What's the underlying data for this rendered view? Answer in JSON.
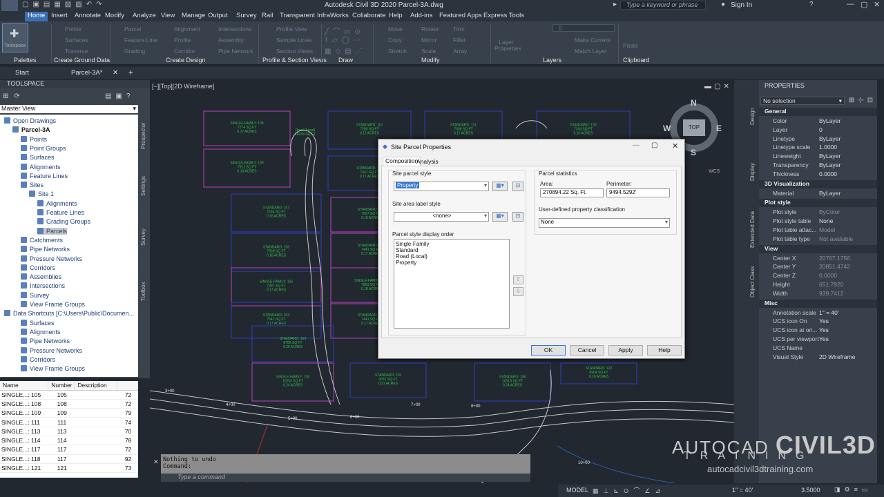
{
  "titlebar": {
    "app_title": "Autodesk Civil 3D 2020   Parcel-3A.dwg",
    "search_placeholder": "Type a keyword or phrase",
    "sign_in": "Sign In",
    "app_button": "C3D"
  },
  "menu_tabs": [
    "Home",
    "Insert",
    "Annotate",
    "Modify",
    "Analyze",
    "View",
    "Manage",
    "Output",
    "Survey",
    "Rail",
    "Transparent",
    "InfraWorks",
    "Collaborate",
    "Help",
    "Add-ins",
    "Featured Apps",
    "Express Tools"
  ],
  "ribbon": {
    "panels": [
      "Palettes",
      "Create Ground Data",
      "Create Design",
      "Profile & Section Views",
      "Draw",
      "Modify",
      "Layers",
      "Clipboard"
    ],
    "toolspace_label": "Toolspace",
    "ground_items": [
      "Points",
      "Surfaces",
      "Traverse"
    ],
    "design_items": [
      "Parcel",
      "Feature Line",
      "Grading",
      "Alignment",
      "Profile",
      "Corridor",
      "Intersections",
      "Assembly",
      "Pipe Network"
    ],
    "profile_items": [
      "Profile View",
      "Sample Lines",
      "Section Views"
    ],
    "modify_items": [
      "Move",
      "Copy",
      "Stretch",
      "Rotate",
      "Mirror",
      "Scale",
      "Trim",
      "Fillet",
      "Array"
    ],
    "layer_items": [
      "Layer Properties",
      "Make Current",
      "Match Layer"
    ],
    "layer_value": "0",
    "paste_label": "Paste"
  },
  "doc_tabs": {
    "start": "Start",
    "file": "Parcel-3A*"
  },
  "toolspace": {
    "title": "TOOLSPACE",
    "view_select": "Master View",
    "side_tabs": [
      "Prospector",
      "Settings",
      "Survey",
      "Toolbox"
    ],
    "tree": [
      {
        "label": "Open Drawings",
        "indent": 0
      },
      {
        "label": "Parcel-3A",
        "indent": 1,
        "bold": true
      },
      {
        "label": "Points",
        "indent": 2
      },
      {
        "label": "Point Groups",
        "indent": 2
      },
      {
        "label": "Surfaces",
        "indent": 2
      },
      {
        "label": "Alignments",
        "indent": 2
      },
      {
        "label": "Feature Lines",
        "indent": 2
      },
      {
        "label": "Sites",
        "indent": 2
      },
      {
        "label": "Site 1",
        "indent": 3
      },
      {
        "label": "Alignments",
        "indent": 4
      },
      {
        "label": "Feature Lines",
        "indent": 4
      },
      {
        "label": "Grading Groups",
        "indent": 4
      },
      {
        "label": "Parcels",
        "indent": 4,
        "selected": true
      },
      {
        "label": "Catchments",
        "indent": 2
      },
      {
        "label": "Pipe Networks",
        "indent": 2
      },
      {
        "label": "Pressure Networks",
        "indent": 2
      },
      {
        "label": "Corridors",
        "indent": 2
      },
      {
        "label": "Assemblies",
        "indent": 2
      },
      {
        "label": "Intersections",
        "indent": 2
      },
      {
        "label": "Survey",
        "indent": 2
      },
      {
        "label": "View Frame Groups",
        "indent": 2
      },
      {
        "label": "Data Shortcuts [C:\\Users\\Public\\Documen...",
        "indent": 0
      },
      {
        "label": "Surfaces",
        "indent": 2
      },
      {
        "label": "Alignments",
        "indent": 2
      },
      {
        "label": "Pipe Networks",
        "indent": 2
      },
      {
        "label": "Pressure Networks",
        "indent": 2
      },
      {
        "label": "Corridors",
        "indent": 2
      },
      {
        "label": "View Frame Groups",
        "indent": 2
      }
    ]
  },
  "list": {
    "headers": [
      "Name",
      "Number",
      "Description",
      ""
    ],
    "rows": [
      [
        "SINGLE...: 105",
        "105",
        "",
        "72"
      ],
      [
        "SINGLE...: 108",
        "108",
        "",
        "72"
      ],
      [
        "SINGLE...: 109",
        "109",
        "",
        "79"
      ],
      [
        "SINGLE...: 111",
        "111",
        "",
        "74"
      ],
      [
        "SINGLE...: 113",
        "113",
        "",
        "70"
      ],
      [
        "SINGLE...: 114",
        "114",
        "",
        "78"
      ],
      [
        "SINGLE...: 117",
        "117",
        "",
        "72"
      ],
      [
        "SINGLE...: 118",
        "117",
        "",
        "92"
      ],
      [
        "SINGLE...: 121",
        "121",
        "",
        "73"
      ]
    ]
  },
  "viewport": {
    "label": "[−][Top][2D Wireframe]",
    "compass": {
      "n": "N",
      "s": "S",
      "e": "E",
      "w": "W",
      "top": "TOP",
      "wcs": "WCS"
    }
  },
  "parcels": [
    {
      "t1": "SINGLE-FAMILY: 108",
      "t2": "7274 SQ FT",
      "t3": "0.17 ACRES",
      "c": "#c040c0"
    },
    {
      "t1": "STANDARD: 110",
      "t2": "7280 SQ FT",
      "t3": "0.17 ACRES",
      "c": "#3040c0"
    },
    {
      "t1": "STANDARD: 131",
      "t2": "7306 SQ FT",
      "t3": "0.17 ACRES",
      "c": "#3040c0"
    },
    {
      "t1": "STANDARD: 130",
      "t2": "7184 SQ FT",
      "t3": "0.16 ACRES",
      "c": "#3040c0"
    },
    {
      "t1": "SINGLE-FAMILY: 109",
      "t2": "7912 SQ FT",
      "t3": "0.18 ACRES",
      "c": "#c040c0"
    },
    {
      "t1": "STANDARD: 111",
      "t2": "7447 SQ FT",
      "t3": "0.17 ACRES",
      "c": "#3040c0"
    },
    {
      "t1": "STANDARD: 107",
      "t2": "7184 SQ FT",
      "t3": "0.16 ACRES",
      "c": "#3040c0"
    },
    {
      "t1": "STANDARD: 112",
      "t2": "7057 SQ FT",
      "t3": "0.16 ACRES",
      "c": "#c040c0"
    },
    {
      "t1": "STANDARD: 106",
      "t2": "7990 SQ FT",
      "t3": "0.18 ACRES",
      "c": "#3040c0"
    },
    {
      "t1": "STANDARD: 113",
      "t2": "7441 SQ FT",
      "t3": "0.17 ACRES",
      "c": "#c040c0"
    },
    {
      "t1": "SINGLE-FAMILY: 105",
      "t2": "7287 SQ FT",
      "t3": "0.17 ACRES",
      "c": "#c040c0"
    },
    {
      "t1": "SINGLE-FAMILY: 114",
      "t2": "7853 SQ FT",
      "t3": "0.18 ACRES",
      "c": "#c040c0"
    },
    {
      "t1": "STANDARD: 104",
      "t2": "7541 SQ FT",
      "t3": "0.17 ACRES",
      "c": "#3040c0"
    },
    {
      "t1": "STANDARD: 115",
      "t2": "7441 SQ FT",
      "t3": "0.17 ACRES",
      "c": "#c040c0"
    },
    {
      "t1": "STANDARD: 103",
      "t2": "8766 SQ FT",
      "t3": "0.20 ACRES",
      "c": "#3040c0"
    },
    {
      "t1": "SINGLE-FAMILY: 118",
      "t2": "10253 SQ FT",
      "t3": "0.24 ACRES",
      "c": "#c040c0"
    },
    {
      "t1": "STANDARD: 119",
      "t2": "9031 SQ FT",
      "t3": "0.21 ACRES",
      "c": "#3040c0"
    },
    {
      "t1": "STANDARD: 136",
      "t2": "10319 SQ FT",
      "t3": "0.24 ACRES",
      "c": "#3040c0"
    },
    {
      "t1": "STANDARD: 120",
      "t2": "6904 SQ FT",
      "t3": "0.16 ACRES",
      "c": "#3040c0"
    },
    {
      "t1": "Road (Local)",
      "t2": "10333 SQ FT",
      "t3": "",
      "c": "#3040c0"
    }
  ],
  "stations": [
    "3+00",
    "4+00",
    "5+00",
    "6+00",
    "7+00",
    "8+00",
    "10+00"
  ],
  "command": {
    "history": [
      "Nothing to undo",
      "Command:"
    ],
    "placeholder": "Type a command"
  },
  "dialog": {
    "title": "Site Parcel Properties",
    "tabs": [
      "Composition",
      "Analysis"
    ],
    "site_parcel_style_label": "Site parcel style",
    "site_parcel_style_value": "Property",
    "site_area_label_style_label": "Site area label style",
    "site_area_label_style_value": "<none>",
    "display_order_label": "Parcel style display order",
    "display_order_items": [
      "Single-Family",
      "Standard",
      "Road (Local)",
      "Property"
    ],
    "stats_label": "Parcel statistics",
    "area_label": "Area:",
    "area_value": "270894.22 Sq. Ft.",
    "perimeter_label": "Perimeter:",
    "perimeter_value": "9494.5292'",
    "udp_label": "User-defined property classification",
    "udp_value": "None",
    "buttons": [
      "OK",
      "Cancel",
      "Apply",
      "Help"
    ]
  },
  "properties": {
    "title": "PROPERTIES",
    "selection": "No selection",
    "side_tabs": [
      "Design",
      "Display",
      "Extended Data",
      "Object Class"
    ],
    "sections": [
      {
        "name": "General",
        "rows": [
          [
            "Color",
            "ByLayer",
            false
          ],
          [
            "Layer",
            "0",
            false
          ],
          [
            "Linetype",
            "ByLayer",
            false
          ],
          [
            "Linetype scale",
            "1.0000",
            false
          ],
          [
            "Lineweight",
            "ByLayer",
            false
          ],
          [
            "Transparency",
            "ByLayer",
            false
          ],
          [
            "Thickness",
            "0.0000",
            false
          ]
        ]
      },
      {
        "name": "3D Visualization",
        "rows": [
          [
            "Material",
            "ByLayer",
            false
          ]
        ]
      },
      {
        "name": "Plot style",
        "rows": [
          [
            "Plot style",
            "ByColor",
            true
          ],
          [
            "Plot style table",
            "None",
            false
          ],
          [
            "Plot table attac...",
            "Model",
            true
          ],
          [
            "Plot table type",
            "Not available",
            true
          ]
        ]
      },
      {
        "name": "View",
        "rows": [
          [
            "Center X",
            "20767.1756",
            true
          ],
          [
            "Center Y",
            "20851.4742",
            true
          ],
          [
            "Center Z",
            "0.0000",
            true
          ],
          [
            "Height",
            "651.7920",
            true
          ],
          [
            "Width",
            "939.7412",
            true
          ]
        ]
      },
      {
        "name": "Misc",
        "rows": [
          [
            "Annotation scale",
            "1\" = 40'",
            false
          ],
          [
            "UCS icon On",
            "Yes",
            false
          ],
          [
            "UCS icon at ori...",
            "Yes",
            false
          ],
          [
            "UCS per viewport",
            "Yes",
            false
          ],
          [
            "UCS Name",
            "",
            false
          ],
          [
            "Visual Style",
            "2D Wireframe",
            false
          ]
        ]
      }
    ]
  },
  "statusbar": {
    "model": "MODEL",
    "scale": "1\" = 40'",
    "value": "3.5000"
  },
  "watermark": {
    "line1a": "AUTOCAD",
    "line1b": "CIVIL3D",
    "line2": "TRAINING",
    "line3": "autocadcivil3dtraining.com"
  }
}
